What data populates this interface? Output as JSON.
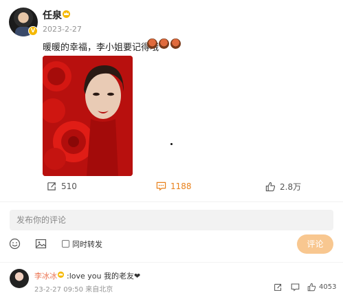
{
  "post": {
    "author": "任泉",
    "date": "2023-2-27",
    "text": "暖暖的幸福，李小姐要记得哦",
    "emoji": [
      "cake-emoji",
      "cake-emoji",
      "cake-emoji"
    ]
  },
  "actions": {
    "forward_count": "510",
    "comment_count": "1188",
    "like_count": "2.8万"
  },
  "composer": {
    "placeholder": "发布你的评论",
    "forward_label": "同时转发",
    "submit_label": "评论"
  },
  "comment": {
    "author": "李冰冰",
    "text": ":love you 我的老友❤",
    "meta": "23-2-27 09:50 来自北京",
    "like_count": "4053"
  },
  "colors": {
    "accent": "#e8801a",
    "submit_bg": "#f8c790",
    "commenter_name": "#eb7350",
    "image_red": "#c41410"
  }
}
